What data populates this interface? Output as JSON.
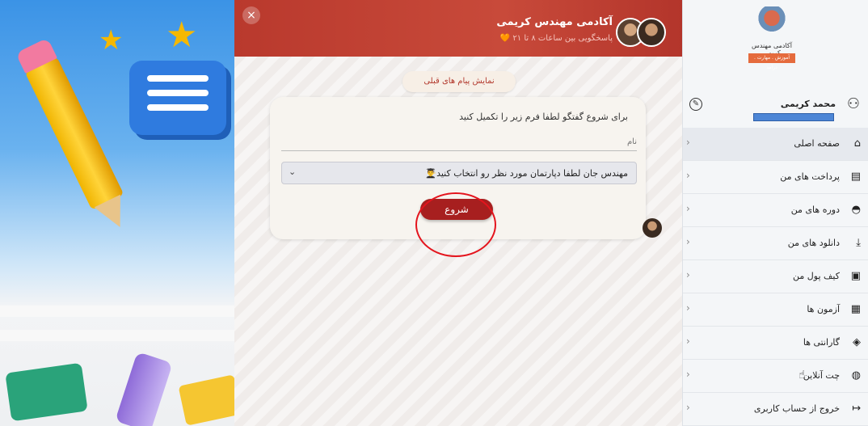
{
  "chat": {
    "close_label": "×",
    "agent_title": "آکادمی مهندس کریمی",
    "agent_subtitle": "پاسخگویی بین ساعات ۸ تا ۲۱ 🧡",
    "previous_messages_label": "نمایش پیام های قبلی",
    "form": {
      "intro": "برای شروع گفتگو لطفا فرم زیر را تکمیل کنید",
      "name_placeholder": "نام",
      "department_selected": "مهندس جان لطفا دپارتمان مورد نظر رو انتخاب کنید👨‍🎓",
      "start_label": "شروع"
    }
  },
  "sidebar": {
    "logo_title": "آکادمی مهندس کریمی",
    "logo_tagline": "آموزش . مهارت . درآمد",
    "user_name": "محمد کریمی",
    "menu": [
      {
        "label": "صفحه اصلی",
        "icon": "home-icon",
        "glyph": "⌂"
      },
      {
        "label": "پرداخت های من",
        "icon": "payment-icon",
        "glyph": "▤"
      },
      {
        "label": "دوره های من",
        "icon": "graduation-cap-icon",
        "glyph": "◓"
      },
      {
        "label": "دانلود های من",
        "icon": "download-icon",
        "glyph": "⤓"
      },
      {
        "label": "کیف پول من",
        "icon": "wallet-icon",
        "glyph": "▣"
      },
      {
        "label": "آزمون ها",
        "icon": "exam-icon",
        "glyph": "▦"
      },
      {
        "label": "گارانتی ها",
        "icon": "shield-icon",
        "glyph": "◈"
      },
      {
        "label": "چت آنلاین",
        "icon": "chat-icon",
        "glyph": "◍"
      },
      {
        "label": "خروج از حساب کاربری",
        "icon": "logout-icon",
        "glyph": "↦"
      }
    ]
  },
  "colors": {
    "header": "#b9392d",
    "start_button": "#a71f1f",
    "highlight_circle": "#e4141d"
  }
}
